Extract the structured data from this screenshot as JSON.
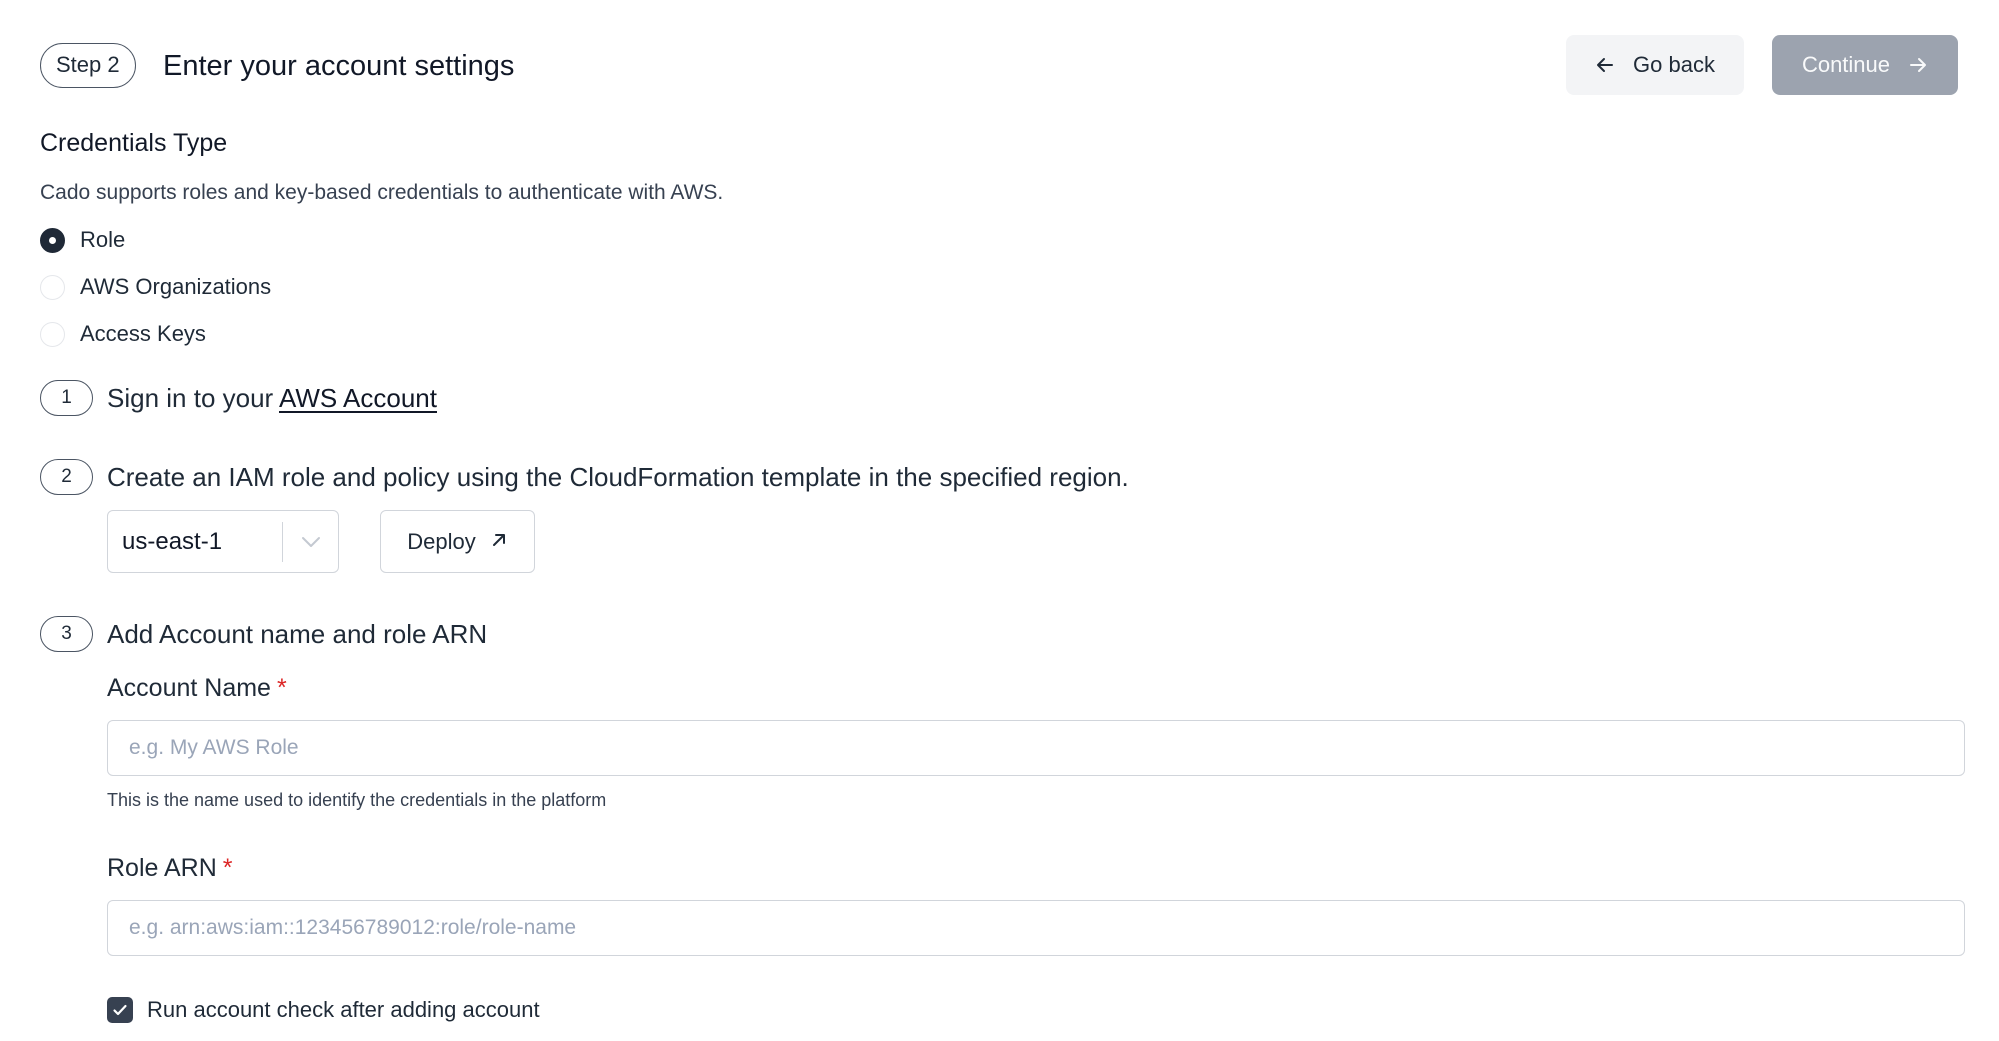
{
  "header": {
    "step_label": "Step 2",
    "title": "Enter your account settings",
    "back_label": "Go back",
    "continue_label": "Continue"
  },
  "credentials": {
    "title": "Credentials Type",
    "description": "Cado supports roles and key-based credentials to authenticate with AWS.",
    "options": [
      {
        "label": "Role",
        "selected": true
      },
      {
        "label": "AWS Organizations",
        "selected": false
      },
      {
        "label": "Access Keys",
        "selected": false
      }
    ]
  },
  "steps": [
    {
      "number": "1",
      "text": "Sign in to your ",
      "link": "AWS Account"
    },
    {
      "number": "2",
      "text": "Create an IAM role and policy using the CloudFormation template in the specified region."
    },
    {
      "number": "3",
      "text": "Add Account name and role ARN"
    }
  ],
  "region": {
    "value": "us-east-1"
  },
  "deploy_label": "Deploy",
  "form": {
    "account_name": {
      "label": "Account Name",
      "required_mark": "*",
      "placeholder": "e.g. My AWS Role",
      "value": "",
      "hint": "This is the name used to identify the credentials in the platform"
    },
    "role_arn": {
      "label": "Role ARN",
      "required_mark": "*",
      "placeholder": "e.g. arn:aws:iam::123456789012:role/role-name",
      "value": ""
    },
    "account_check": {
      "label": "Run account check after adding account",
      "checked": true
    }
  },
  "icons": {
    "back": "arrow-left-icon",
    "continue": "arrow-right-icon",
    "region": "chevron-down-icon",
    "deploy": "arrow-up-right-icon",
    "check": "check-icon"
  },
  "colors": {
    "continue_bg": "#9ca3af",
    "back_bg": "#f3f4f6",
    "required": "#dc2626",
    "checkbox": "#374151"
  }
}
